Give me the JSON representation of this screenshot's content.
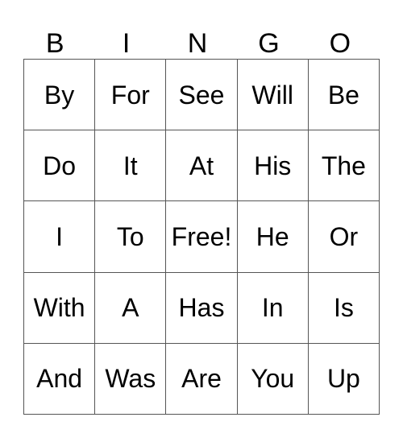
{
  "card": {
    "title": "BINGO",
    "header_letters": [
      "B",
      "I",
      "N",
      "G",
      "O"
    ],
    "free_space_label": "Free!",
    "free_space_position": {
      "row": 3,
      "column": 3
    },
    "grid_size": "5x5",
    "colors": {
      "background": "#ffffff",
      "text": "#000000",
      "grid_line": "#555555"
    },
    "columns": {
      "B": [
        "By",
        "Do",
        "I",
        "With",
        "And"
      ],
      "I": [
        "For",
        "It",
        "To",
        "A",
        "Was"
      ],
      "N": [
        "See",
        "At",
        "Free!",
        "Has",
        "Are"
      ],
      "G": [
        "Will",
        "His",
        "He",
        "In",
        "You"
      ],
      "O": [
        "Be",
        "The",
        "Or",
        "Is",
        "Up"
      ]
    },
    "rows": [
      [
        "By",
        "For",
        "See",
        "Will",
        "Be"
      ],
      [
        "Do",
        "It",
        "At",
        "His",
        "The"
      ],
      [
        "I",
        "To",
        "Free!",
        "He",
        "Or"
      ],
      [
        "With",
        "A",
        "Has",
        "In",
        "Is"
      ],
      [
        "And",
        "Was",
        "Are",
        "You",
        "Up"
      ]
    ]
  }
}
